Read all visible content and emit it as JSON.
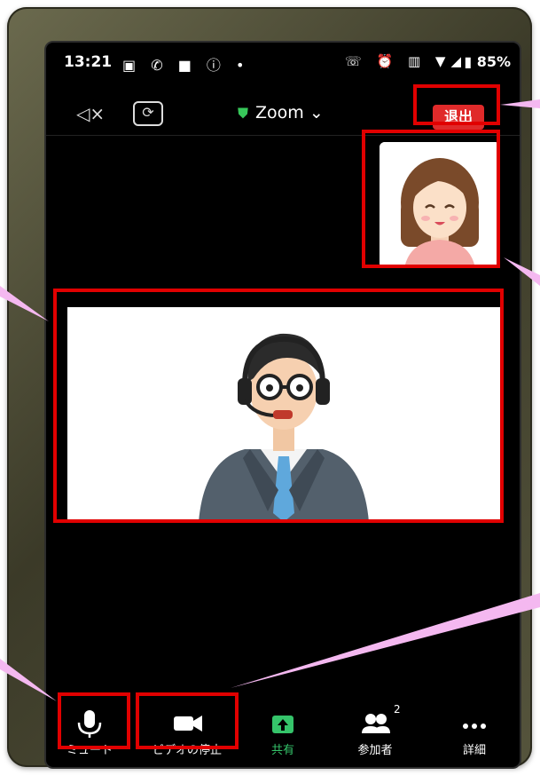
{
  "status_bar": {
    "time": "13:21",
    "left_icons": "▣ ✆ ■ ⓘ •",
    "right_icons": "☏ ⏰ ▥ ▼◢",
    "battery": "85%"
  },
  "top_bar": {
    "app_label": "Zoom ⌄",
    "leave_button": "退出"
  },
  "toolbar": {
    "items": [
      {
        "label": "ミュート",
        "icon": "mic-icon"
      },
      {
        "label": "ビデオの停止",
        "icon": "video-camera-icon"
      },
      {
        "label": "共有",
        "icon": "share-icon"
      },
      {
        "label": "参加者",
        "icon": "participants-icon",
        "badge": "2"
      },
      {
        "label": "詳細",
        "icon": "more-icon"
      }
    ]
  },
  "colors": {
    "highlight": "#e10000",
    "annotation_arrow": "#f4b8f0",
    "leave": "#e02a2a",
    "share_green": "#35c46a"
  }
}
